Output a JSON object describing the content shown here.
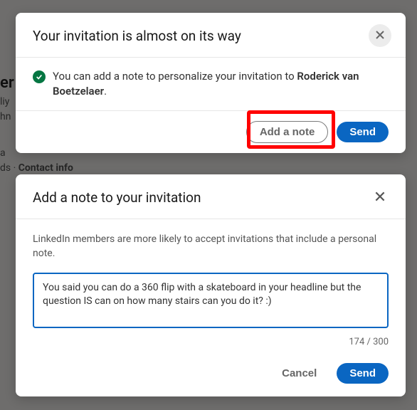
{
  "modal1": {
    "title": "Your invitation is almost on its way",
    "info_prefix": "You can add a note to personalize your invitation to ",
    "recipient_name": "Roderick van Boetzelaer",
    "info_suffix": ".",
    "add_note_label": "Add a note",
    "send_label": "Send"
  },
  "modal2": {
    "title": "Add a note to your invitation",
    "hint": "LinkedIn members are more likely to accept invitations that include a personal note.",
    "note_value": "You said you can do a 360 flip with a skateboard in your headline but the question IS can on how many stairs can you do it? :)",
    "char_count": "174 / 300",
    "cancel_label": "Cancel",
    "send_label": "Send"
  },
  "background": {
    "contact_info": "Contact info"
  }
}
